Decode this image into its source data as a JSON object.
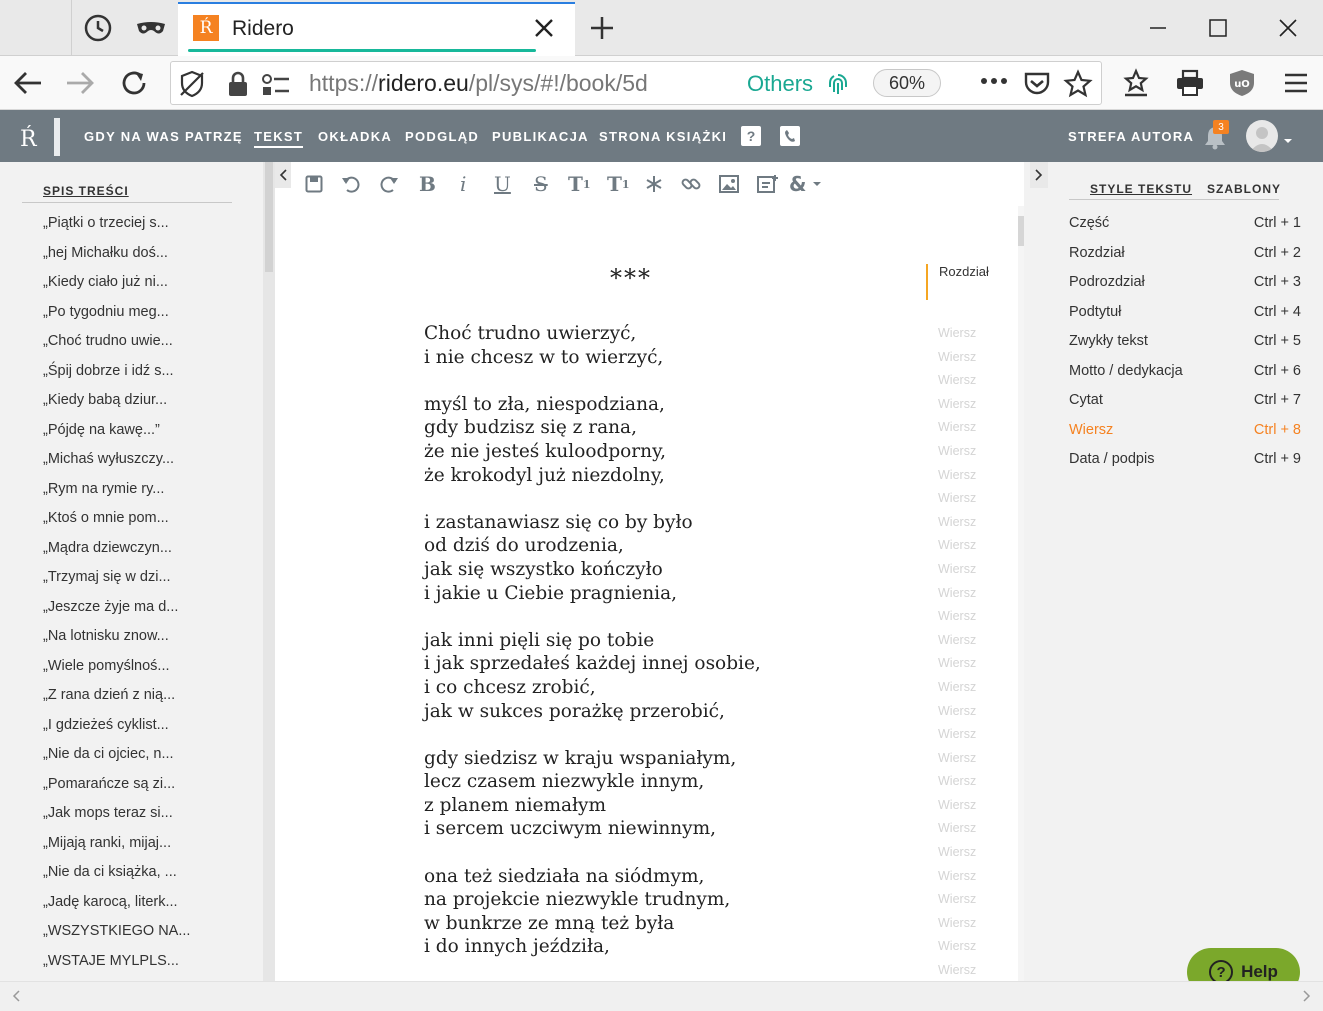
{
  "browser": {
    "tab_title": "Ridero",
    "favicon_letter": "Ŕ",
    "url_prefix": "https://",
    "url_host": "ridero.eu",
    "url_path": "/pl/sys/#!/book/5d",
    "container_label": "Others",
    "zoom": "60%"
  },
  "app": {
    "book_title": "GDY NA WAS PATRZĘ",
    "nav": [
      "TEKST",
      "OKŁADKA",
      "PODGLĄD",
      "PUBLIKACJA",
      "STRONA KSIĄŻKI"
    ],
    "active_nav": "TEKST",
    "help_square": "?",
    "author_zone": "STREFA AUTORA",
    "notification_count": "3"
  },
  "toc": {
    "header": "SPIS TREŚCI",
    "items": [
      "„Piątki o trzeciej s...",
      "„hej Michałku doś...",
      "„Kiedy ciało już ni...",
      "„Po tygodniu meg...",
      "„Choć trudno uwie...",
      "„Śpij dobrze i idź s...",
      "„Kiedy babą dziur...",
      "„Pójdę na kawę...”",
      "„Michaś wyłuszczy...",
      "„Rym na rymie ry...",
      "„Ktoś o mnie pom...",
      "„Mądra dziewczyn...",
      "„Trzymaj się w dzi...",
      "„Jeszcze żyje ma d...",
      "„Na lotnisku znow...",
      "„Wiele pomyślnoś...",
      "„Z rana dzień z nią...",
      "„I gdzieżeś cyklist...",
      "„Nie da ci ojciec, n...",
      "„Pomarańcze są zi...",
      "„Jak mops teraz si...",
      "„Mijają ranki, mijaj...",
      "„Nie da ci książka, ...",
      "„Jadę karocą, literk...",
      "„WSZYSTKIEGO NA...",
      "„WSTAJE MYLPLS..."
    ]
  },
  "editor": {
    "heading": "***",
    "heading_style": "Rozdział",
    "line_style": "Wiersz",
    "lines": [
      "Choć trudno uwierzyć,",
      "i nie chcesz w to wierzyć,",
      "",
      "myśl to zła, niespodziana,",
      "gdy budzisz się z rana,",
      "że nie jesteś kuloodporny,",
      "że krokodyl już niezdolny,",
      "",
      "i zastanawiasz się co by było",
      "od dziś do urodzenia,",
      "jak się wszystko kończyło",
      "i jakie u Ciebie pragnienia,",
      "",
      "jak inni pięli się po tobie",
      "i jak sprzedałeś każdej innej osobie,",
      "i co chcesz zrobić,",
      "jak w sukces porażkę przerobić,",
      "",
      "gdy siedzisz w kraju wspaniałym,",
      "lecz czasem niezwykle innym,",
      "z planem niemałym",
      "i sercem uczciwym niewinnym,",
      "",
      "ona też siedziała na siódmym,",
      "na projekcie niezwykle trudnym,",
      "w bunkrze ze mną też była",
      "i do innych jeździła,",
      ""
    ]
  },
  "toolbar": {
    "bold": "B",
    "italic": "i",
    "underline": "U",
    "strike": "S",
    "subscript": "T",
    "subscript_mark": "1",
    "superscript": "T",
    "superscript_mark": "1",
    "special": "&"
  },
  "styles_panel": {
    "tabs": [
      "STYLE TEKSTU",
      "SZABLONY"
    ],
    "active_tab": "STYLE TEKSTU",
    "items": [
      {
        "name": "Część",
        "shortcut": "Ctrl + 1"
      },
      {
        "name": "Rozdział",
        "shortcut": "Ctrl + 2"
      },
      {
        "name": "Podrozdział",
        "shortcut": "Ctrl + 3"
      },
      {
        "name": "Podtytuł",
        "shortcut": "Ctrl + 4"
      },
      {
        "name": "Zwykły tekst",
        "shortcut": "Ctrl + 5"
      },
      {
        "name": "Motto / dedykacja",
        "shortcut": "Ctrl + 6"
      },
      {
        "name": "Cytat",
        "shortcut": "Ctrl + 7"
      },
      {
        "name": "Wiersz",
        "shortcut": "Ctrl + 8"
      },
      {
        "name": "Data / podpis",
        "shortcut": "Ctrl + 9"
      }
    ],
    "active_style": "Wiersz"
  },
  "help": {
    "label": "Help",
    "icon": "?"
  },
  "colors": {
    "accent": "#f58221",
    "header": "#6f7a82",
    "help": "#7ba82b",
    "loading": "#17b89a"
  }
}
